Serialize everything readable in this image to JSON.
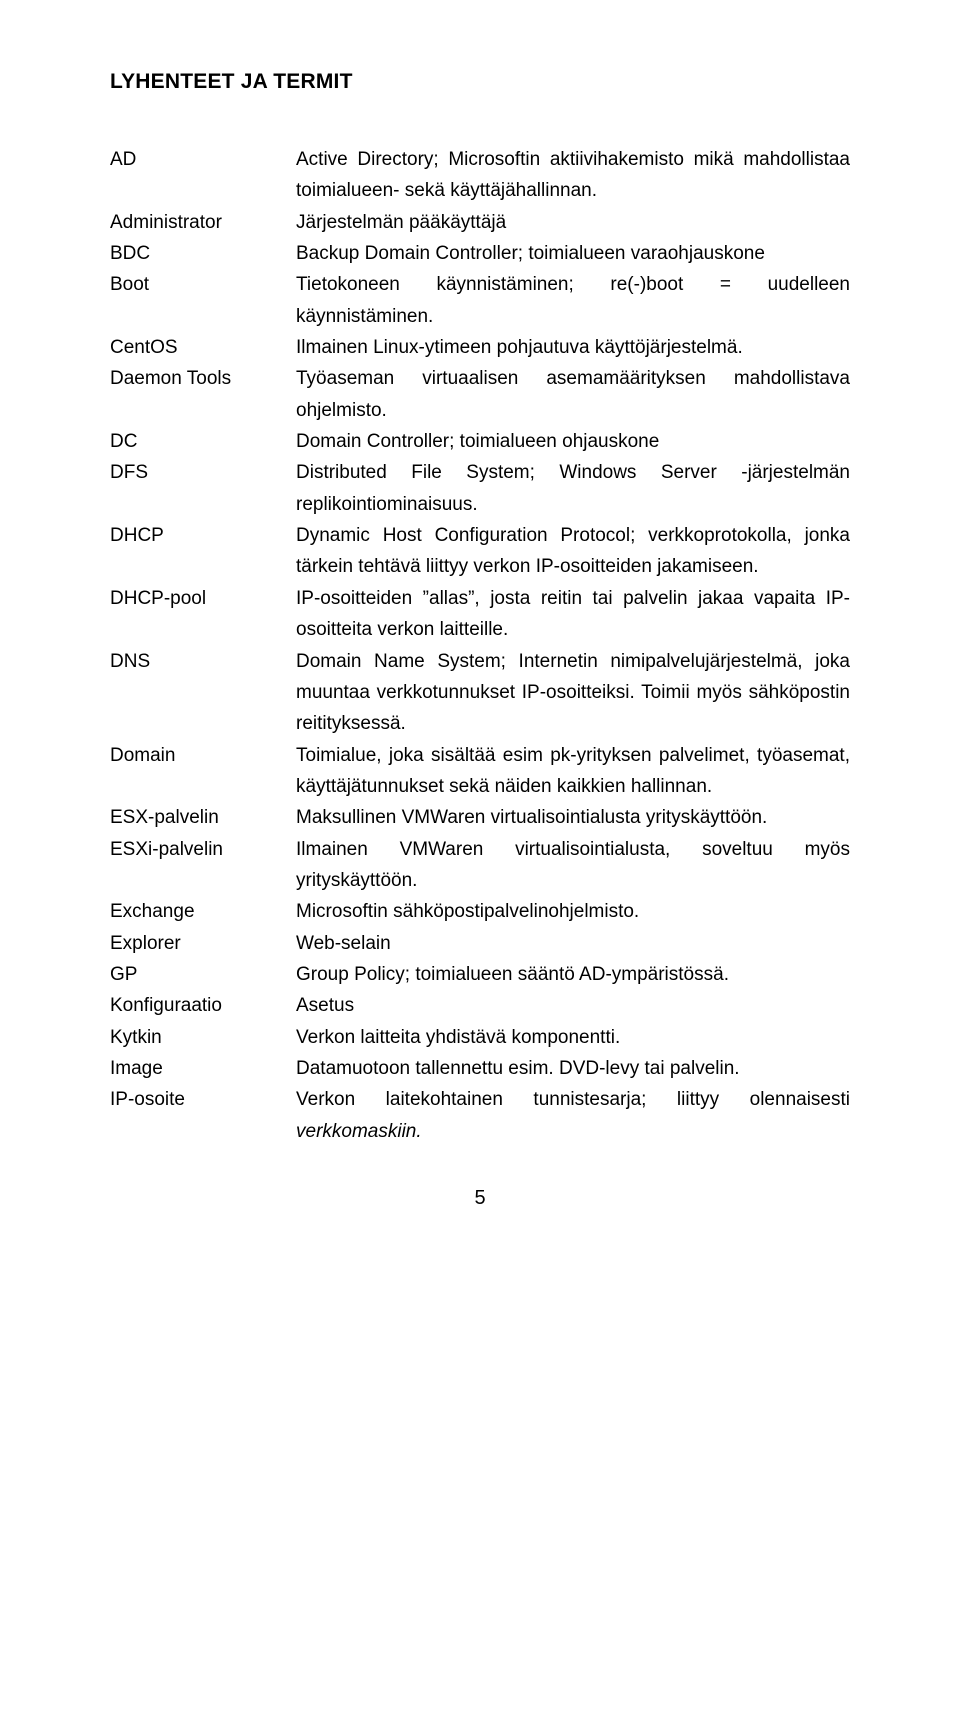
{
  "title": "LYHENTEET JA TERMIT",
  "pageNumber": "5",
  "terms": [
    {
      "abbr": "AD",
      "def": "Active Directory; Microsoftin aktiivihakemisto mikä mahdollistaa toimialueen- sekä käyttäjähallinnan."
    },
    {
      "abbr": "Administrator",
      "def": "Järjestelmän pääkäyttäjä"
    },
    {
      "abbr": "BDC",
      "def": "Backup Domain Controller; toimialueen varaohjauskone"
    },
    {
      "abbr": "Boot",
      "def": "Tietokoneen käynnistäminen; re(-)boot = uudelleen käynnistäminen."
    },
    {
      "abbr": "CentOS",
      "def": "Ilmainen Linux-ytimeen pohjautuva käyttöjärjestelmä."
    },
    {
      "abbr": "Daemon Tools",
      "def": "Työaseman virtuaalisen asemamäärityksen mahdollistava ohjelmisto."
    },
    {
      "abbr": "DC",
      "def": "Domain Controller; toimialueen ohjauskone"
    },
    {
      "abbr": "DFS",
      "def": "Distributed File System; Windows Server -järjestelmän replikointiominaisuus."
    },
    {
      "abbr": "DHCP",
      "def": "Dynamic Host Configuration Protocol; verkkoprotokolla, jonka tärkein tehtävä liittyy verkon IP-osoitteiden jakamiseen."
    },
    {
      "abbr": "DHCP-pool",
      "def": "IP-osoitteiden ”allas”, josta reitin tai palvelin jakaa vapaita IP-osoitteita verkon laitteille."
    },
    {
      "abbr": "DNS",
      "def": "Domain Name System; Internetin nimipalvelujärjestelmä, joka muuntaa verkkotunnukset IP-osoitteiksi. Toimii myös sähköpostin reitityksessä."
    },
    {
      "abbr": "Domain",
      "def": "Toimialue, joka sisältää esim pk-yrityksen palvelimet, työasemat, käyttäjätunnukset sekä näiden kaikkien hallinnan."
    },
    {
      "abbr": "ESX-palvelin",
      "def": "Maksullinen VMWaren virtualisointialusta yrityskäyttöön."
    },
    {
      "abbr": "ESXi-palvelin",
      "def": "Ilmainen VMWaren virtualisointialusta, soveltuu myös yrityskäyttöön."
    },
    {
      "abbr": "Exchange",
      "def": "Microsoftin sähköpostipalvelinohjelmisto."
    },
    {
      "abbr": "Explorer",
      "def": "Web-selain"
    },
    {
      "abbr": "GP",
      "def": "Group Policy; toimialueen sääntö AD-ympäristössä."
    },
    {
      "abbr": "Konfiguraatio",
      "def": "Asetus"
    },
    {
      "abbr": "Kytkin",
      "def": "Verkon laitteita yhdistävä komponentti."
    },
    {
      "abbr": "Image",
      "def": "Datamuotoon tallennettu esim. DVD-levy tai palvelin."
    },
    {
      "abbr": "IP-osoite",
      "def": "Verkon laitekohtainen tunnistesarja; liittyy olennaisesti",
      "italicSuffix": "verkkomaskiin."
    }
  ]
}
